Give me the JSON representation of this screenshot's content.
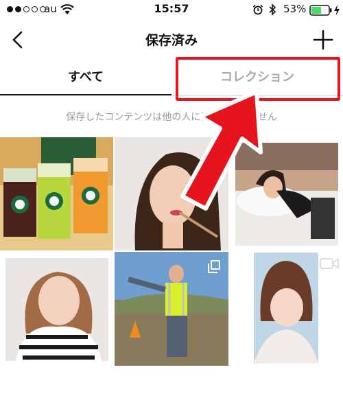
{
  "status_bar": {
    "carrier": "au",
    "time": "15:57",
    "battery": "53%"
  },
  "nav": {
    "title": "保存済み",
    "back_icon": "chevron-left-icon",
    "add_icon": "plus-icon"
  },
  "tabs": [
    {
      "label": "すべて",
      "active": true
    },
    {
      "label": "コレクション",
      "active": false
    }
  ],
  "notice": "保存したコンテンツは他の人には表示されません",
  "grid": {
    "items": [
      {
        "kind": "photo",
        "subject": "three iced drinks"
      },
      {
        "kind": "photo",
        "subject": "woman applying lipstick"
      },
      {
        "kind": "photo",
        "subject": "woman lying on bed"
      },
      {
        "kind": "photo",
        "subject": "woman in striped sweater"
      },
      {
        "kind": "photo",
        "subject": "man in safety vest",
        "badge": "multiple-photos-icon"
      },
      {
        "kind": "video",
        "subject": "woman portrait",
        "badge": "video-icon"
      }
    ]
  },
  "colors": {
    "highlight": "#e8141d",
    "tab_active": "#111111",
    "tab_inactive": "#a7a7a7",
    "notice_text": "#999999"
  }
}
